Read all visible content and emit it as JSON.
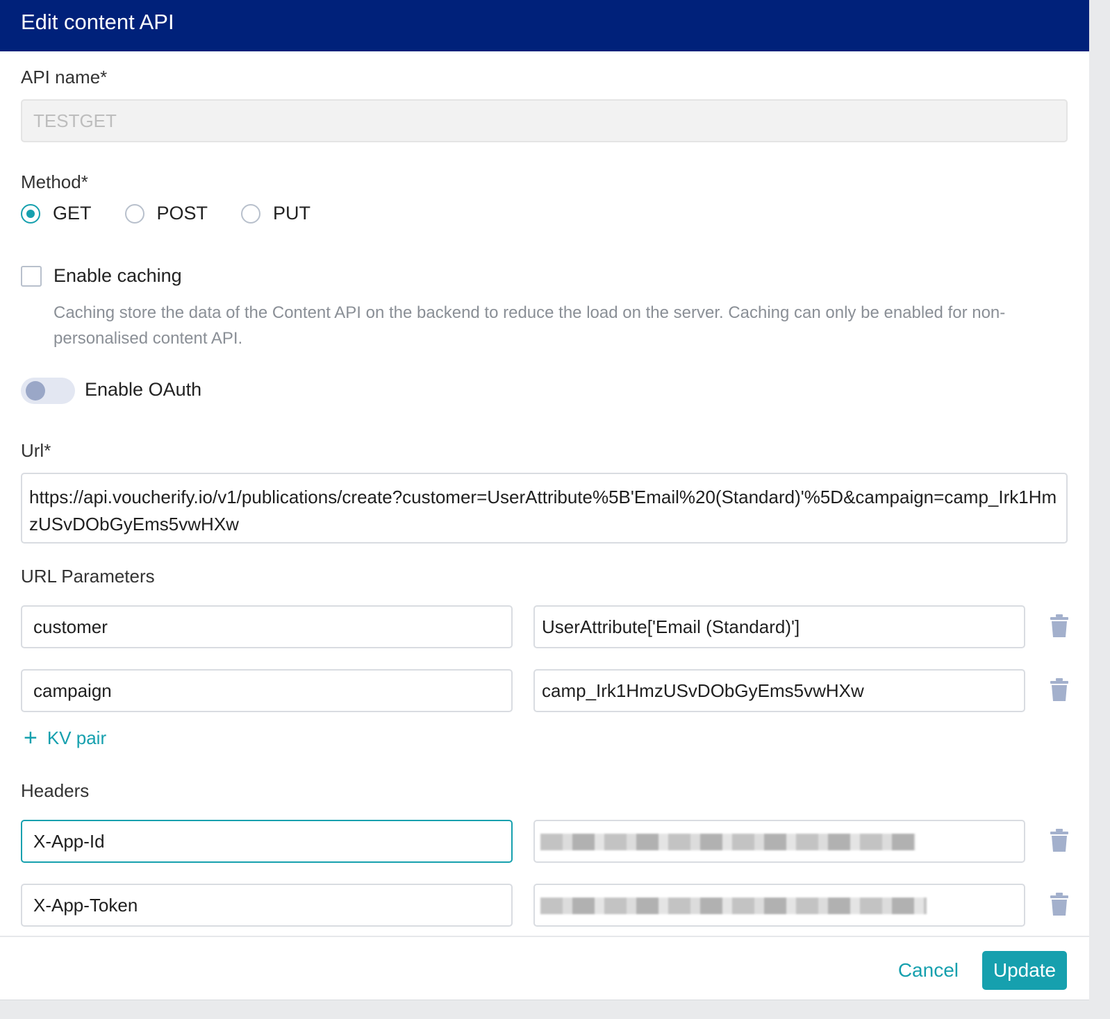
{
  "dialog": {
    "title": "Edit content API"
  },
  "api_name": {
    "label": "API name*",
    "value": "TESTGET"
  },
  "method": {
    "label": "Method*",
    "options": [
      "GET",
      "POST",
      "PUT"
    ],
    "selected": "GET"
  },
  "caching": {
    "label": "Enable caching",
    "checked": false,
    "helper": "Caching store the data of the Content API on the backend to reduce the load on the server. Caching can only be enabled for non-personalised content API."
  },
  "oauth": {
    "label": "Enable OAuth",
    "enabled": false
  },
  "url": {
    "label": "Url*",
    "value": "https://api.voucherify.io/v1/publications/create?customer=UserAttribute%5B'Email%20(Standard)'%5D&campaign=camp_Irk1HmzUSvDObGyEms5vwHXw"
  },
  "url_params": {
    "label": "URL Parameters",
    "rows": [
      {
        "key": "customer",
        "value": "UserAttribute['Email (Standard)']"
      },
      {
        "key": "campaign",
        "value": "camp_Irk1HmzUSvDObGyEms5vwHXw"
      }
    ],
    "add_label": "KV pair"
  },
  "headers": {
    "label": "Headers",
    "rows": [
      {
        "key": "X-App-Id"
      },
      {
        "key": "X-App-Token"
      }
    ]
  },
  "footer": {
    "cancel_label": "Cancel",
    "update_label": "Update"
  },
  "colors": {
    "header_bg": "#00217a",
    "accent": "#16a0ae"
  },
  "icons": {
    "trash": "trash-icon",
    "plus": "plus-icon"
  }
}
